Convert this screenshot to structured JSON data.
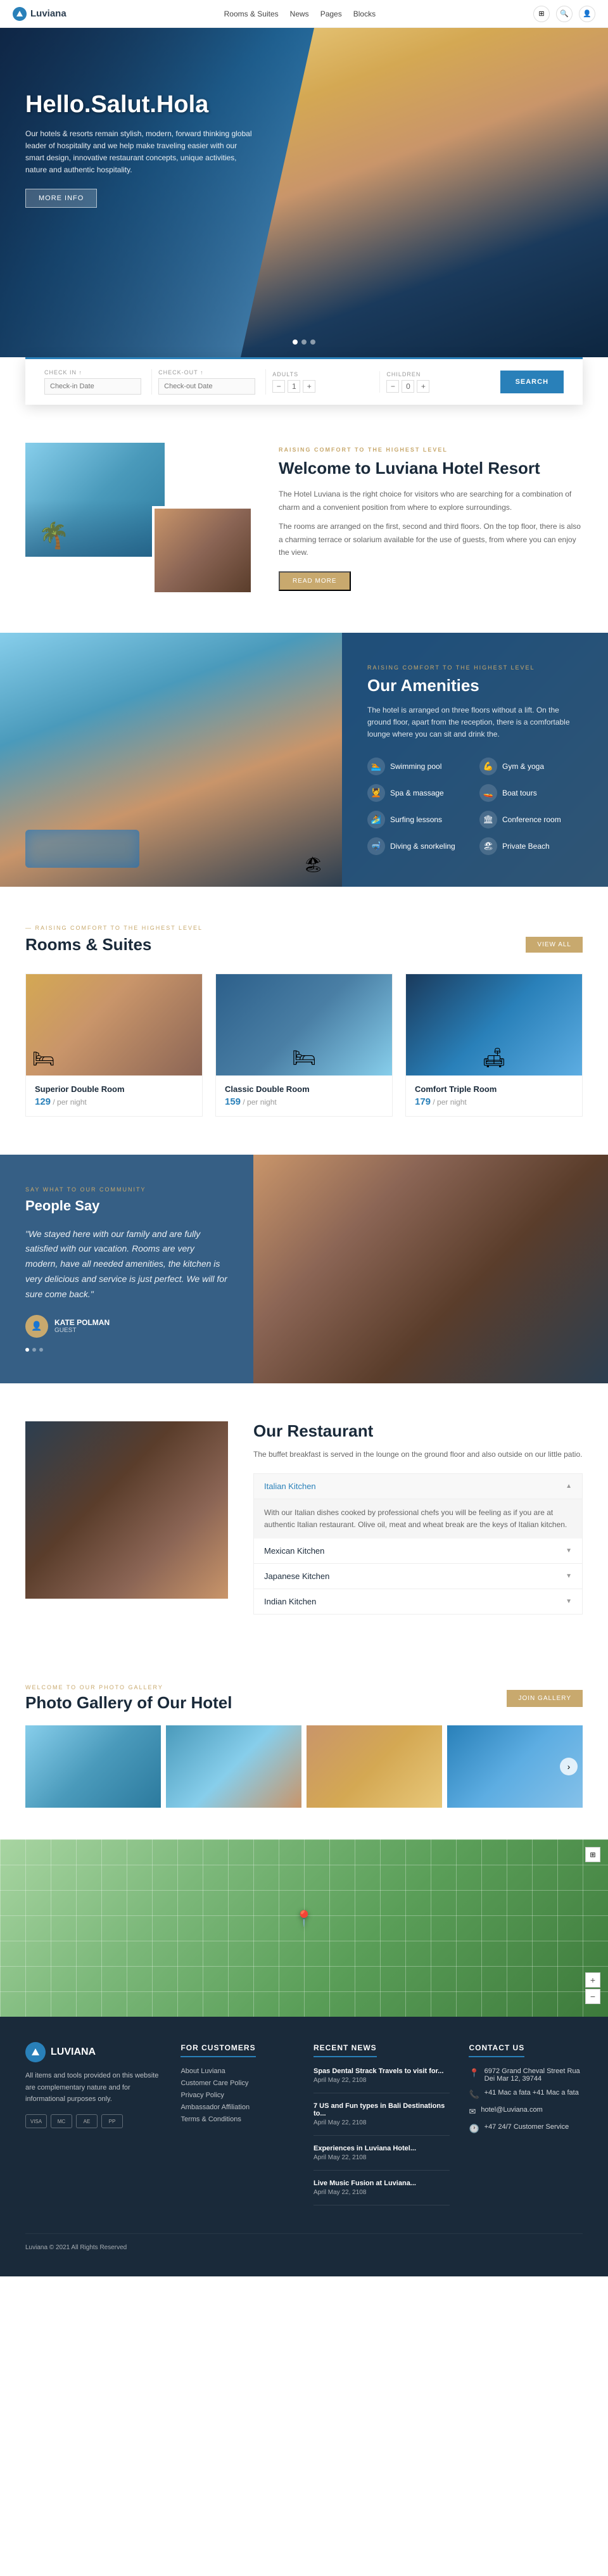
{
  "header": {
    "logo_text": "Luviana",
    "nav": [
      {
        "label": "Rooms & Suites",
        "has_dropdown": true
      },
      {
        "label": "News",
        "has_dropdown": true
      },
      {
        "label": "Pages",
        "has_dropdown": true
      },
      {
        "label": "Blocks",
        "has_dropdown": true
      }
    ],
    "actions": [
      "grid-icon",
      "search-icon",
      "user-icon"
    ]
  },
  "hero": {
    "title": "Hello.Salut.Hola",
    "subtitle": "Our hotels & resorts remain stylish, modern, forward thinking global leader of hospitality and we help make traveling easier with our smart design, innovative restaurant concepts, unique activities, nature and authentic hospitality.",
    "cta_label": "MORE INFO",
    "dots": [
      true,
      false,
      false
    ]
  },
  "booking": {
    "checkin_label": "Check in ↑",
    "checkout_label": "Check-out ↑",
    "adults_label": "Adults",
    "children_label": "Children",
    "checkin_placeholder": "Check-in Date",
    "checkout_placeholder": "Check-out Date",
    "adults_value": "1",
    "children_value": "0",
    "search_label": "SEARCH"
  },
  "welcome": {
    "section_label": "RAISING COMFORT TO THE HIGHEST LEVEL",
    "title": "Welcome to Luviana Hotel Resort",
    "text1": "The Hotel Luviana is the right choice for visitors who are searching for a combination of charm and a convenient position from where to explore surroundings.",
    "text2": "The rooms are arranged on the first, second and third floors. On the top floor, there is also a charming terrace or solarium available for the use of guests, from where you can enjoy the view.",
    "cta_label": "READ MORE"
  },
  "amenities": {
    "section_label": "RAISING COMFORT TO THE HIGHEST LEVEL",
    "title": "Our Amenities",
    "text": "The hotel is arranged on three floors without a lift. On the ground floor, apart from the reception, there is a comfortable lounge where you can sit and drink the.",
    "items": [
      {
        "icon": "🏊",
        "label": "Swimming pool"
      },
      {
        "icon": "💪",
        "label": "Gym & yoga"
      },
      {
        "icon": "💆",
        "label": "Spa & massage"
      },
      {
        "icon": "🚤",
        "label": "Boat tours"
      },
      {
        "icon": "🏄",
        "label": "Surfing lessons"
      },
      {
        "icon": "🏛",
        "label": "Conference room"
      },
      {
        "icon": "🤿",
        "label": "Diving & snorkeling"
      },
      {
        "icon": "🏖",
        "label": "Private Beach"
      }
    ]
  },
  "rooms": {
    "section_label": "RAISING COMFORT TO THE HIGHEST LEVEL",
    "title": "Rooms & Suites",
    "view_all_label": "VIEW ALL",
    "items": [
      {
        "name": "Superior Double Room",
        "price": "129",
        "per_night": "/ per night"
      },
      {
        "name": "Classic Double Room",
        "price": "159",
        "per_night": "/ per night"
      },
      {
        "name": "Comfort Triple Room",
        "price": "179",
        "per_night": "/ per night"
      }
    ]
  },
  "testimonial": {
    "section_label": "SAY WHAT TO OUR COMMUNITY",
    "title": "People Say",
    "quote": "\"We stayed here with our family and are fully satisfied with our vacation. Rooms are very modern, have all needed amenities, the kitchen is very delicious and service is just perfect. We will for sure come back.\"",
    "author_name": "KATE POLMAN",
    "author_role": "GUEST"
  },
  "restaurant": {
    "title": "Our Restaurant",
    "desc": "The buffet breakfast is served in the lounge on the ground floor and also outside on our little patio.",
    "kitchens": [
      {
        "name": "Italian Kitchen",
        "active": true,
        "text": "With our Italian dishes cooked by professional chefs you will be feeling as if you are at authentic Italian restaurant. Olive oil, meat and wheat break are the keys of Italian kitchen."
      },
      {
        "name": "Mexican Kitchen",
        "active": false
      },
      {
        "name": "Japanese Kitchen",
        "active": false
      },
      {
        "name": "Indian Kitchen",
        "active": false
      }
    ]
  },
  "gallery": {
    "section_label": "WELCOME TO OUR PHOTO GALLERY",
    "title": "Photo Gallery of Our Hotel",
    "cta_label": "JOIN GALLERY"
  },
  "footer": {
    "logo_text": "LUVIANA",
    "desc": "All items and tools provided on this website are complementary nature and for informational purposes only.",
    "payments": [
      "VISA",
      "MC",
      "AE",
      "PP"
    ],
    "columns": {
      "customers": {
        "title": "For Customers",
        "links": [
          "About Luviana",
          "Customer Care Policy",
          "Privacy Policy",
          "Ambassador Affiliation",
          "Terms & Conditions"
        ]
      },
      "news": {
        "title": "Recent News",
        "items": [
          {
            "title": "Spas Dental Strack Travels to visit for...",
            "date": "April May 22, 2108"
          },
          {
            "title": "7 US and Fun types in Bali Destinations to...",
            "date": "April May 22, 2108"
          },
          {
            "title": "Experiences in Luviana Hotel...",
            "date": "April May 22, 2108"
          },
          {
            "title": "Live Music Fusion at Luviana...",
            "date": "April May 22, 2108"
          }
        ]
      },
      "contact": {
        "title": "Contact Us",
        "address": "6972 Grand Cheval Street Rua Dei Mar 12, 39744",
        "phone1": "+41 Mac a fata +41 Mac a fata",
        "email": "hotel@Luviana.com",
        "support": "+47 24/7 Customer Service"
      }
    },
    "copyright": "Luviana © 2021 All Rights Reserved"
  }
}
